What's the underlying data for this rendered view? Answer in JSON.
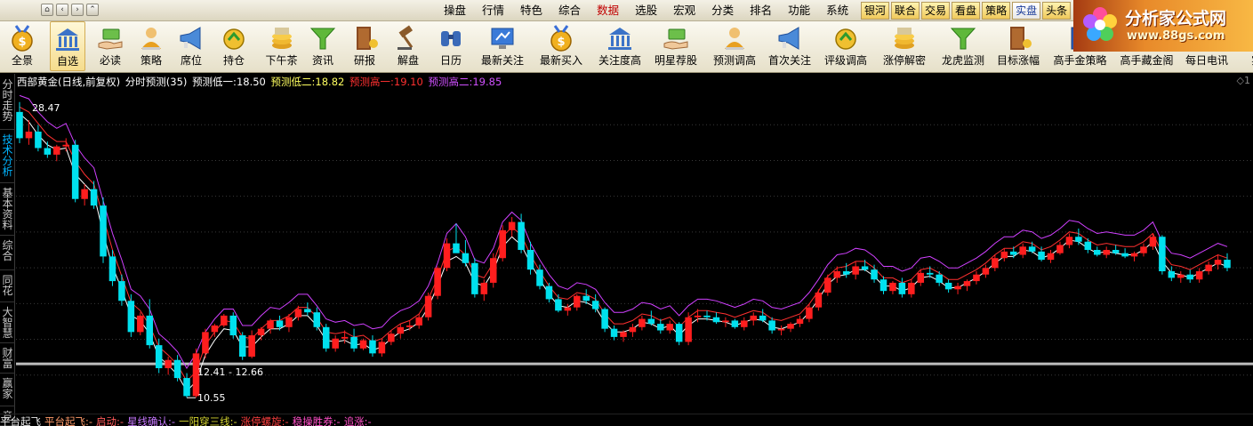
{
  "menu": {
    "items": [
      {
        "label": "操盘"
      },
      {
        "label": "行情"
      },
      {
        "label": "特色"
      },
      {
        "label": "综合"
      },
      {
        "label": "数据",
        "active": true
      },
      {
        "label": "选股"
      },
      {
        "label": "宏观"
      },
      {
        "label": "分类"
      },
      {
        "label": "排名"
      },
      {
        "label": "功能"
      },
      {
        "label": "系统"
      }
    ],
    "tabs": [
      {
        "label": "银河"
      },
      {
        "label": "联合"
      },
      {
        "label": "交易"
      },
      {
        "label": "看盘"
      },
      {
        "label": "策略"
      },
      {
        "label": "实盘",
        "highlight": true
      },
      {
        "label": "头条"
      }
    ],
    "window_icons": [
      "home-icon",
      "back-icon",
      "forward-icon",
      "up-icon"
    ]
  },
  "logo": {
    "title": "分析家公式网",
    "url": "www.88gs.com",
    "colors": {
      "orange": "#e88a2a",
      "dark": "#a53b12"
    }
  },
  "toolbar": {
    "items": [
      {
        "label": "全景",
        "icon": "medal"
      },
      {
        "label": "自选",
        "icon": "bank",
        "selected": true
      },
      {
        "label": "必读",
        "icon": "hand-money"
      },
      {
        "label": "策略",
        "icon": "person"
      },
      {
        "label": "席位",
        "icon": "megaphone"
      },
      {
        "label": "持仓",
        "icon": "coin-arrow"
      },
      {
        "label": "下午茶",
        "icon": "coins"
      },
      {
        "label": "资讯",
        "icon": "funnel"
      },
      {
        "label": "研报",
        "icon": "door"
      },
      {
        "label": "解盘",
        "icon": "gavel"
      },
      {
        "label": "日历",
        "icon": "binoculars"
      },
      {
        "label": "最新关注",
        "icon": "monitor"
      },
      {
        "label": "最新买入",
        "icon": "medal"
      },
      {
        "label": "关注度高",
        "icon": "bank"
      },
      {
        "label": "明星荐股",
        "icon": "hand-money"
      },
      {
        "label": "预测调高",
        "icon": "person"
      },
      {
        "label": "首次关注",
        "icon": "megaphone"
      },
      {
        "label": "评级调高",
        "icon": "coin-arrow"
      },
      {
        "label": "涨停解密",
        "icon": "coins"
      },
      {
        "label": "龙虎监测",
        "icon": "funnel"
      },
      {
        "label": "目标涨幅",
        "icon": "door"
      },
      {
        "label": "高手金策略",
        "icon": "book"
      },
      {
        "label": "高手藏金阁",
        "icon": "book"
      },
      {
        "label": "每日电讯",
        "icon": "book"
      },
      {
        "label": "实",
        "icon": "book"
      }
    ]
  },
  "side_tabs": [
    {
      "label": "分时走势"
    },
    {
      "label": "技术分析",
      "active": true
    },
    {
      "label": "基本资料"
    },
    {
      "label": "综合"
    },
    {
      "label": "同花"
    },
    {
      "label": "大智慧"
    },
    {
      "label": "财富"
    },
    {
      "label": "赢家"
    },
    {
      "label": "竞"
    }
  ],
  "info": {
    "stock": "西部黄金(日线,前复权)",
    "indicator": "分时预测(35)",
    "low1_label": "预测低一:",
    "low1_value": "18.50",
    "low2_label": "预测低二:",
    "low2_value": "18.82",
    "high1_label": "预测高一:",
    "high1_value": "19.10",
    "high2_label": "预测高二:",
    "high2_value": "19.85",
    "corner": "◇1"
  },
  "bottom": {
    "items": [
      {
        "label": "平台起飞",
        "color": "#e8e8e8"
      },
      {
        "label": "平台起飞:-",
        "color": "#ff9b6a"
      },
      {
        "label": "启动:-",
        "color": "#ff5a5a"
      },
      {
        "label": "星线确认:-",
        "color": "#c878ff"
      },
      {
        "label": "一阳穿三线:-",
        "color": "#d0d030"
      },
      {
        "label": "涨停螺旋:-",
        "color": "#ff4040"
      },
      {
        "label": "稳操胜券:-",
        "color": "#ff50c8"
      },
      {
        "label": "追涨:-",
        "color": "#ff50c8"
      }
    ]
  },
  "chart_data": {
    "type": "candlestick",
    "ylim": [
      9.8,
      29.4
    ],
    "annotations": {
      "high_label": "28.47",
      "low_label": "10.55",
      "range_label": "12.41 - 12.66"
    },
    "reference_line": 12.66,
    "colors": {
      "up": "#ff1e1e",
      "down": "#00e0ee",
      "white": "#ffffff",
      "red_line": "#ff3030",
      "purple": "#d040ff"
    },
    "ohlc": [
      [
        28.0,
        28.6,
        26.1,
        26.4
      ],
      [
        26.4,
        27.5,
        26.0,
        26.8
      ],
      [
        26.8,
        27.2,
        25.6,
        25.8
      ],
      [
        25.8,
        26.2,
        25.2,
        25.4
      ],
      [
        25.4,
        26.0,
        25.0,
        25.9
      ],
      [
        25.9,
        26.4,
        25.6,
        26.0
      ],
      [
        26.0,
        26.3,
        22.5,
        22.7
      ],
      [
        22.7,
        23.6,
        22.3,
        23.3
      ],
      [
        23.3,
        23.8,
        22.1,
        22.3
      ],
      [
        22.3,
        22.8,
        18.8,
        19.2
      ],
      [
        19.2,
        19.6,
        17.4,
        17.7
      ],
      [
        17.7,
        18.1,
        16.2,
        16.5
      ],
      [
        16.5,
        16.9,
        14.3,
        14.6
      ],
      [
        14.6,
        15.8,
        14.4,
        15.6
      ],
      [
        15.6,
        16.6,
        13.6,
        13.8
      ],
      [
        13.8,
        14.2,
        12.1,
        12.4
      ],
      [
        12.4,
        13.1,
        12.0,
        12.9
      ],
      [
        12.9,
        13.2,
        11.6,
        11.8
      ],
      [
        11.8,
        12.1,
        10.6,
        10.7
      ],
      [
        10.7,
        13.6,
        10.6,
        13.3
      ],
      [
        13.3,
        14.8,
        13.0,
        14.6
      ],
      [
        14.6,
        15.1,
        14.3,
        15.0
      ],
      [
        15.0,
        15.7,
        14.9,
        15.6
      ],
      [
        15.6,
        15.8,
        14.2,
        14.4
      ],
      [
        14.4,
        14.6,
        12.9,
        13.1
      ],
      [
        13.1,
        14.7,
        13.0,
        14.4
      ],
      [
        14.4,
        14.9,
        14.1,
        14.8
      ],
      [
        14.8,
        15.4,
        14.5,
        15.3
      ],
      [
        15.3,
        15.6,
        14.7,
        14.9
      ],
      [
        14.9,
        15.7,
        14.6,
        15.5
      ],
      [
        15.5,
        16.2,
        15.3,
        16.0
      ],
      [
        16.0,
        16.4,
        15.6,
        15.8
      ],
      [
        15.8,
        16.1,
        14.7,
        14.9
      ],
      [
        14.9,
        15.1,
        13.4,
        13.6
      ],
      [
        13.6,
        14.4,
        13.4,
        14.2
      ],
      [
        14.2,
        14.7,
        13.9,
        14.3
      ],
      [
        14.3,
        14.8,
        13.4,
        13.6
      ],
      [
        13.6,
        14.2,
        13.5,
        14.1
      ],
      [
        14.1,
        14.4,
        13.1,
        13.3
      ],
      [
        13.3,
        14.2,
        13.1,
        14.0
      ],
      [
        14.0,
        14.7,
        13.8,
        14.5
      ],
      [
        14.5,
        15.1,
        14.2,
        14.9
      ],
      [
        14.9,
        15.3,
        14.7,
        15.0
      ],
      [
        15.0,
        15.7,
        14.8,
        15.5
      ],
      [
        15.5,
        17.0,
        15.3,
        16.8
      ],
      [
        16.8,
        18.6,
        16.6,
        18.5
      ],
      [
        18.5,
        20.3,
        18.3,
        20.0
      ],
      [
        20.0,
        21.2,
        19.6,
        19.4
      ],
      [
        19.4,
        20.2,
        18.6,
        18.8
      ],
      [
        18.8,
        19.1,
        16.7,
        16.9
      ],
      [
        16.9,
        17.8,
        16.5,
        17.6
      ],
      [
        17.6,
        19.4,
        17.3,
        19.1
      ],
      [
        19.1,
        21.1,
        18.9,
        20.8
      ],
      [
        20.8,
        21.6,
        20.4,
        21.3
      ],
      [
        21.3,
        21.8,
        19.4,
        19.6
      ],
      [
        19.6,
        20.1,
        18.1,
        18.4
      ],
      [
        18.4,
        18.7,
        17.2,
        17.4
      ],
      [
        17.4,
        17.6,
        16.4,
        16.6
      ],
      [
        16.6,
        16.9,
        15.8,
        15.9
      ],
      [
        15.9,
        16.3,
        15.6,
        16.1
      ],
      [
        16.1,
        16.9,
        15.9,
        16.8
      ],
      [
        16.8,
        17.2,
        16.3,
        16.5
      ],
      [
        16.5,
        16.9,
        15.8,
        16.0
      ],
      [
        16.0,
        16.1,
        14.6,
        14.8
      ],
      [
        14.8,
        15.0,
        14.1,
        14.3
      ],
      [
        14.3,
        14.7,
        14.0,
        14.6
      ],
      [
        14.6,
        15.1,
        14.3,
        14.9
      ],
      [
        14.9,
        15.6,
        14.7,
        15.4
      ],
      [
        15.4,
        15.9,
        15.0,
        15.1
      ],
      [
        15.1,
        15.4,
        14.5,
        14.7
      ],
      [
        14.7,
        15.3,
        14.5,
        15.1
      ],
      [
        15.1,
        15.2,
        13.8,
        14.0
      ],
      [
        14.0,
        15.8,
        13.8,
        15.5
      ],
      [
        15.5,
        16.0,
        15.2,
        15.6
      ],
      [
        15.6,
        15.9,
        15.3,
        15.5
      ],
      [
        15.5,
        15.8,
        15.1,
        15.2
      ],
      [
        15.2,
        15.5,
        14.9,
        15.3
      ],
      [
        15.3,
        15.4,
        14.8,
        14.9
      ],
      [
        14.9,
        15.5,
        14.7,
        15.3
      ],
      [
        15.3,
        15.8,
        15.0,
        15.6
      ],
      [
        15.6,
        16.0,
        15.2,
        15.3
      ],
      [
        15.3,
        15.5,
        14.5,
        14.7
      ],
      [
        14.7,
        15.0,
        14.4,
        14.8
      ],
      [
        14.8,
        15.2,
        14.6,
        15.1
      ],
      [
        15.1,
        15.6,
        14.9,
        15.4
      ],
      [
        15.4,
        16.3,
        15.2,
        16.1
      ],
      [
        16.1,
        17.2,
        15.9,
        17.0
      ],
      [
        17.0,
        18.1,
        16.8,
        17.9
      ],
      [
        17.9,
        18.6,
        17.6,
        18.3
      ],
      [
        18.3,
        18.8,
        17.9,
        18.1
      ],
      [
        18.1,
        18.9,
        17.8,
        18.6
      ],
      [
        18.6,
        19.0,
        18.3,
        18.4
      ],
      [
        18.4,
        18.7,
        17.6,
        17.8
      ],
      [
        17.8,
        18.0,
        16.9,
        17.1
      ],
      [
        17.1,
        17.7,
        16.9,
        17.6
      ],
      [
        17.6,
        17.9,
        16.7,
        16.9
      ],
      [
        16.9,
        17.8,
        16.7,
        17.6
      ],
      [
        17.6,
        18.4,
        17.4,
        18.2
      ],
      [
        18.2,
        18.6,
        17.9,
        18.1
      ],
      [
        18.1,
        18.3,
        17.4,
        17.6
      ],
      [
        17.6,
        17.8,
        17.0,
        17.2
      ],
      [
        17.2,
        17.6,
        16.9,
        17.4
      ],
      [
        17.4,
        17.8,
        17.1,
        17.7
      ],
      [
        17.7,
        18.3,
        17.5,
        18.1
      ],
      [
        18.1,
        18.7,
        17.9,
        18.5
      ],
      [
        18.5,
        19.3,
        18.3,
        19.1
      ],
      [
        19.1,
        19.7,
        18.9,
        19.5
      ],
      [
        19.5,
        19.8,
        19.1,
        19.3
      ],
      [
        19.3,
        20.0,
        19.1,
        19.8
      ],
      [
        19.8,
        20.1,
        19.4,
        19.5
      ],
      [
        19.5,
        19.8,
        18.9,
        19.0
      ],
      [
        19.0,
        19.6,
        18.8,
        19.4
      ],
      [
        19.4,
        20.1,
        19.3,
        19.9
      ],
      [
        19.9,
        20.6,
        19.7,
        20.4
      ],
      [
        20.4,
        20.9,
        19.9,
        20.1
      ],
      [
        20.1,
        20.3,
        19.4,
        19.6
      ],
      [
        19.6,
        19.8,
        19.2,
        19.3
      ],
      [
        19.3,
        19.8,
        19.1,
        19.6
      ],
      [
        19.6,
        19.9,
        19.3,
        19.4
      ],
      [
        19.4,
        19.7,
        19.1,
        19.2
      ],
      [
        19.2,
        19.5,
        18.9,
        19.4
      ],
      [
        19.4,
        20.0,
        19.2,
        19.8
      ],
      [
        19.8,
        20.6,
        19.6,
        20.4
      ],
      [
        20.4,
        20.5,
        18.1,
        18.3
      ],
      [
        18.3,
        18.6,
        17.7,
        17.9
      ],
      [
        17.9,
        18.3,
        17.6,
        18.1
      ],
      [
        18.1,
        18.4,
        17.6,
        17.8
      ],
      [
        17.8,
        18.5,
        17.6,
        18.3
      ],
      [
        18.3,
        18.9,
        18.1,
        18.7
      ],
      [
        18.7,
        19.3,
        18.4,
        19.0
      ],
      [
        19.0,
        19.4,
        18.3,
        18.5
      ]
    ],
    "line_white": [
      27.9,
      27.4,
      26.6,
      26.0,
      25.7,
      25.8,
      24.2,
      23.6,
      23.0,
      20.6,
      18.6,
      17.2,
      15.6,
      15.3,
      14.5,
      13.1,
      12.6,
      12.0,
      11.0,
      11.6,
      13.2,
      14.1,
      14.8,
      14.7,
      13.7,
      13.7,
      14.3,
      14.8,
      14.8,
      15.1,
      15.6,
      15.6,
      15.0,
      14.1,
      14.0,
      14.1,
      13.8,
      13.9,
      13.5,
      13.7,
      14.2,
      14.6,
      14.8,
      15.2,
      16.1,
      17.4,
      18.9,
      19.2,
      18.8,
      17.6,
      17.4,
      18.3,
      19.8,
      20.4,
      19.9,
      18.8,
      17.8,
      16.9,
      16.2,
      16.1,
      16.5,
      16.4,
      16.1,
      15.2,
      14.6,
      14.6,
      14.8,
      15.2,
      15.1,
      14.8,
      15.0,
      14.4,
      15.0,
      15.4,
      15.4,
      15.3,
      15.2,
      15.0,
      15.2,
      15.4,
      15.3,
      14.9,
      14.8,
      15.0,
      15.2,
      15.8,
      16.6,
      17.5,
      18.0,
      18.1,
      18.4,
      18.4,
      18.0,
      17.4,
      17.4,
      17.1,
      17.3,
      17.9,
      18.0,
      17.7,
      17.3,
      17.3,
      17.6,
      17.9,
      18.3,
      18.8,
      19.2,
      19.2,
      19.6,
      19.5,
      19.1,
      19.3,
      19.7,
      20.2,
      20.1,
      19.7,
      19.4,
      19.5,
      19.4,
      19.3,
      19.3,
      19.6,
      20.1,
      18.9,
      18.2,
      18.1,
      17.9,
      18.2,
      18.5,
      18.8,
      18.6
    ],
    "line_red": [
      28.3,
      28.0,
      27.3,
      26.6,
      26.2,
      26.2,
      25.0,
      24.2,
      23.6,
      21.6,
      19.6,
      18.0,
      16.4,
      15.9,
      15.0,
      13.7,
      13.2,
      12.6,
      11.6,
      12.2,
      13.8,
      14.6,
      15.3,
      15.2,
      14.3,
      14.2,
      14.8,
      15.3,
      15.3,
      15.6,
      16.1,
      16.1,
      15.5,
      14.6,
      14.5,
      14.6,
      14.3,
      14.4,
      14.0,
      14.2,
      14.7,
      15.1,
      15.3,
      15.7,
      16.6,
      17.9,
      19.5,
      19.8,
      19.3,
      18.1,
      17.9,
      18.8,
      20.4,
      21.0,
      20.5,
      19.3,
      18.3,
      17.4,
      16.7,
      16.6,
      17.0,
      16.9,
      16.6,
      15.7,
      15.1,
      15.1,
      15.3,
      15.7,
      15.6,
      15.3,
      15.5,
      14.9,
      15.5,
      15.9,
      15.9,
      15.8,
      15.7,
      15.5,
      15.7,
      15.9,
      15.8,
      15.4,
      15.3,
      15.5,
      15.7,
      16.3,
      17.1,
      18.0,
      18.5,
      18.6,
      18.9,
      18.9,
      18.5,
      17.9,
      17.9,
      17.6,
      17.8,
      18.4,
      18.5,
      18.2,
      17.8,
      17.8,
      18.1,
      18.4,
      18.8,
      19.3,
      19.7,
      19.7,
      20.1,
      20.0,
      19.6,
      19.8,
      20.2,
      20.7,
      20.6,
      20.2,
      19.9,
      20.0,
      19.9,
      19.8,
      19.8,
      20.1,
      20.6,
      19.4,
      18.7,
      18.6,
      18.4,
      18.7,
      19.0,
      19.3,
      19.1
    ],
    "line_purple": [
      29.0,
      28.8,
      28.0,
      27.4,
      27.0,
      27.3,
      26.0,
      25.2,
      24.6,
      22.6,
      20.6,
      19.0,
      17.2,
      16.8,
      16.0,
      14.5,
      14.0,
      13.4,
      12.4,
      13.3,
      14.6,
      15.4,
      16.0,
      16.0,
      15.0,
      15.0,
      15.6,
      16.1,
      16.0,
      16.4,
      16.9,
      16.9,
      16.2,
      15.4,
      15.2,
      15.3,
      15.0,
      15.1,
      14.8,
      14.9,
      15.5,
      15.9,
      16.1,
      16.5,
      17.4,
      18.8,
      20.6,
      21.2,
      20.4,
      19.0,
      18.8,
      19.7,
      21.3,
      21.9,
      21.4,
      20.0,
      19.0,
      18.1,
      17.4,
      17.2,
      17.6,
      17.5,
      17.2,
      16.4,
      15.8,
      15.8,
      16.0,
      16.4,
      16.3,
      16.0,
      16.2,
      15.6,
      16.2,
      16.6,
      16.6,
      16.5,
      16.3,
      16.1,
      16.3,
      16.6,
      16.5,
      16.1,
      16.0,
      16.2,
      16.4,
      17.0,
      17.8,
      18.7,
      19.3,
      19.4,
      19.7,
      19.6,
      19.2,
      18.6,
      18.6,
      18.3,
      18.5,
      19.1,
      19.2,
      18.9,
      18.5,
      18.5,
      18.8,
      19.1,
      19.5,
      20.0,
      20.4,
      20.4,
      20.8,
      20.7,
      20.3,
      20.5,
      20.9,
      21.4,
      21.3,
      20.9,
      20.6,
      20.7,
      20.6,
      20.5,
      20.5,
      20.8,
      21.3,
      20.1,
      19.4,
      19.3,
      19.1,
      19.4,
      19.7,
      20.0,
      19.8
    ]
  }
}
